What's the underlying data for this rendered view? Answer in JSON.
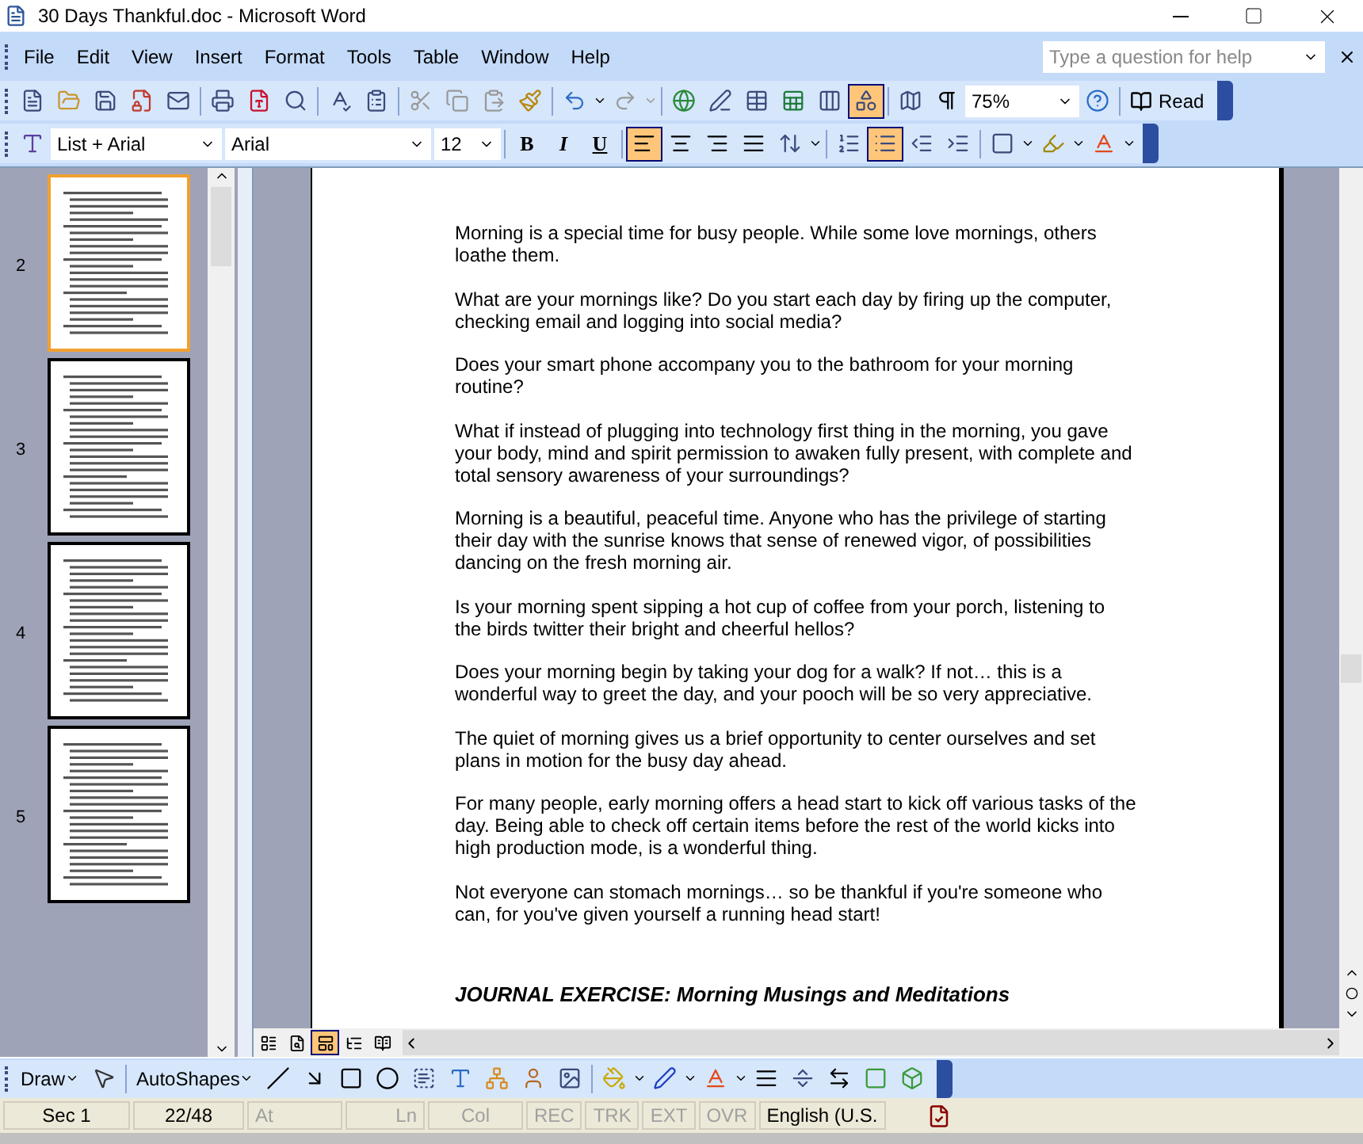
{
  "window": {
    "title": "30 Days Thankful.doc - Microsoft Word"
  },
  "menu": [
    "File",
    "Edit",
    "View",
    "Insert",
    "Format",
    "Tools",
    "Table",
    "Window",
    "Help"
  ],
  "help_box": {
    "placeholder": "Type a question for help"
  },
  "standard_toolbar": {
    "drawing_toggle": {
      "selected": true
    },
    "zoom": "75%",
    "read": "Read"
  },
  "formatting_toolbar": {
    "style": "List + Arial",
    "font": "Arial",
    "size": "12",
    "emphasis": [
      {
        "label": "B",
        "selected": false
      },
      {
        "label": "I",
        "selected": false
      },
      {
        "label": "U",
        "selected": false
      }
    ],
    "align": [
      {
        "selected": true
      },
      {
        "selected": false
      },
      {
        "selected": false
      },
      {
        "selected": false
      }
    ],
    "lists": [
      {
        "selected": false
      },
      {
        "selected": true
      }
    ]
  },
  "thumbnails": [
    {
      "number": "2",
      "selected": true
    },
    {
      "number": "3",
      "selected": false
    },
    {
      "number": "4",
      "selected": false
    },
    {
      "number": "5",
      "selected": false
    }
  ],
  "document": {
    "paragraphs": [
      "Morning is a special time for busy people. While some love mornings, others loathe them.",
      "What are your mornings like? Do you start each day by firing up the computer, checking email and logging into social media?",
      "Does your smart phone accompany you to the bathroom for your morning routine?",
      "What if instead of plugging into technology first thing in the morning, you gave your body, mind and spirit permission to awaken fully present, with complete and total sensory awareness of your surroundings?",
      "Morning is a beautiful, peaceful time. Anyone who has the privilege of starting their day with the sunrise knows that sense of renewed vigor, of possibilities dancing on the fresh morning air.",
      "Is your morning spent sipping a hot cup of coffee from your porch, listening to the birds twitter their bright and cheerful hellos?",
      "Does your morning begin by taking your dog for a walk? If not… this is a wonderful way to greet the day, and your pooch will be so very appreciative.",
      "The quiet of morning gives us a brief opportunity to center ourselves and set plans in motion for the busy day ahead.",
      "For many people, early morning offers a head start to kick off various tasks of the day. Being able to check off certain items before the rest of the world kicks into high production mode, is a wonderful thing.",
      "Not everyone can stomach mornings… so be thankful if you're someone who can, for you've given yourself a running head start!"
    ],
    "heading": "JOURNAL EXERCISE: Morning Musings and Meditations"
  },
  "views": [
    {
      "selected": false
    },
    {
      "selected": false
    },
    {
      "selected": true
    },
    {
      "selected": false
    },
    {
      "selected": false
    }
  ],
  "drawing_toolbar": {
    "draw": "Draw",
    "autoshapes": "AutoShapes"
  },
  "status_bar": [
    {
      "text": "Sec 1",
      "disabled": false
    },
    {
      "text": "22/48",
      "disabled": false
    },
    {
      "text": "At",
      "disabled": true
    },
    {
      "text": "Ln",
      "disabled": true
    },
    {
      "text": "Col",
      "disabled": true
    },
    {
      "text": "REC",
      "disabled": true
    },
    {
      "text": "TRK",
      "disabled": true
    },
    {
      "text": "EXT",
      "disabled": true
    },
    {
      "text": "OVR",
      "disabled": true
    },
    {
      "text": "English (U.S.",
      "disabled": false
    }
  ]
}
